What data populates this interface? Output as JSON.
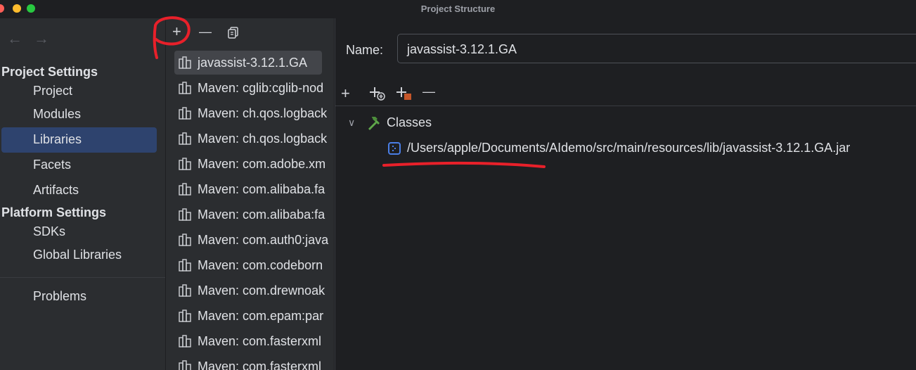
{
  "window": {
    "title": "Project Structure"
  },
  "nav": {
    "back": "←",
    "forward": "→"
  },
  "sidebar": {
    "project_settings": "Project Settings",
    "items_project": [
      "Project",
      "Modules",
      "Libraries",
      "Facets",
      "Artifacts"
    ],
    "platform_settings": "Platform Settings",
    "items_platform": [
      "SDKs",
      "Global Libraries"
    ],
    "problems": "Problems",
    "selected": "Libraries"
  },
  "libraries": {
    "toolbar": {
      "add": "+",
      "remove": "—"
    },
    "items": [
      "javassist-3.12.1.GA",
      "Maven: cglib:cglib-nod",
      "Maven: ch.qos.logback",
      "Maven: ch.qos.logback",
      "Maven: com.adobe.xm",
      "Maven: com.alibaba.fa",
      "Maven: com.alibaba:fa",
      "Maven: com.auth0:java",
      "Maven: com.codeborn",
      "Maven: com.drewnoak",
      "Maven: com.epam:par",
      "Maven: com.fasterxml",
      "Maven: com.fasterxml"
    ],
    "selected_index": 0
  },
  "detail": {
    "name_label": "Name:",
    "name_value": "javassist-3.12.1.GA",
    "toolbar": {
      "add": "+",
      "remove": "—"
    },
    "tree": {
      "chevron": "∨",
      "root": "Classes",
      "entry": "/Users/apple/Documents/AIdemo/src/main/resources/lib/javassist-3.12.1.GA.jar"
    }
  },
  "colors": {
    "accent_selected": "#2e436e",
    "annotation": "#e8202a",
    "hammer": "#5fa84a",
    "jar_icon": "#4a7ee6"
  }
}
